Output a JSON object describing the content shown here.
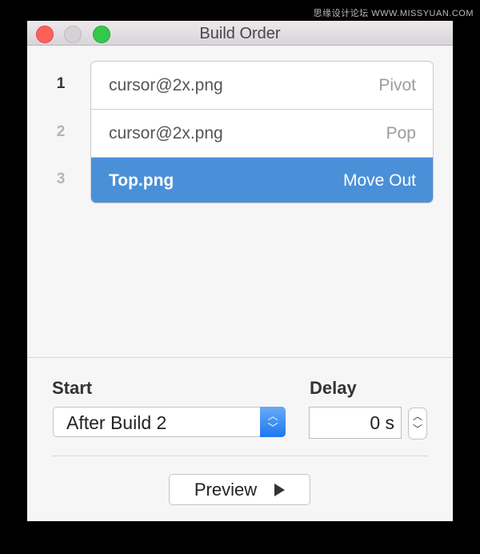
{
  "watermark": "思缘设计论坛 WWW.MISSYUAN.COM",
  "window": {
    "title": "Build Order"
  },
  "builds": [
    {
      "number": "1",
      "name": "cursor@2x.png",
      "action": "Pivot",
      "selected": false
    },
    {
      "number": "2",
      "name": "cursor@2x.png",
      "action": "Pop",
      "selected": false
    },
    {
      "number": "3",
      "name": "Top.png",
      "action": "Move Out",
      "selected": true
    }
  ],
  "start": {
    "label": "Start",
    "value": "After Build 2"
  },
  "delay": {
    "label": "Delay",
    "value": "0 s"
  },
  "preview_label": "Preview",
  "colors": {
    "selection": "#4a90d8",
    "popup_arrow": "#1e78f0"
  }
}
